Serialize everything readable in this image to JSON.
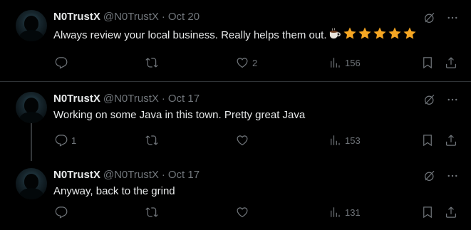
{
  "tweets": [
    {
      "name": "N0TrustX",
      "handle": "@N0TrustX",
      "separator": "·",
      "date": "Oct 20",
      "text": "Always review your local business. Really helps them out.",
      "emoji": [
        "coffee-icon",
        "star-icon",
        "star-icon",
        "star-icon",
        "star-icon",
        "star-icon"
      ],
      "replies": "",
      "retweets": "",
      "likes": "2",
      "views": "156"
    },
    {
      "name": "N0TrustX",
      "handle": "@N0TrustX",
      "separator": "·",
      "date": "Oct 17",
      "text": "Working on some Java in this town. Pretty great Java",
      "replies": "1",
      "retweets": "",
      "likes": "",
      "views": "153"
    },
    {
      "name": "N0TrustX",
      "handle": "@N0TrustX",
      "separator": "·",
      "date": "Oct 17",
      "text": "Anyway, back to the grind",
      "replies": "",
      "retweets": "",
      "likes": "",
      "views": "131"
    }
  ],
  "colors": {
    "background": "#000000",
    "text": "#e7e9ea",
    "muted": "#71767b",
    "divider": "#2f3336",
    "star": "#f5a623"
  }
}
